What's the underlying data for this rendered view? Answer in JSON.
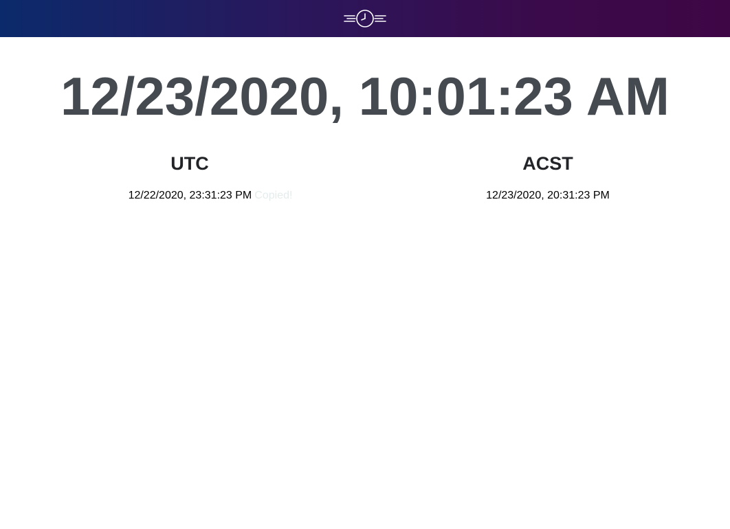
{
  "header": {
    "logo_icon": "clock-speed-icon",
    "gradient": [
      "#0b2a6b",
      "#3e0645"
    ]
  },
  "main": {
    "local_time": "12/23/2020, 10:01:23 AM",
    "color": "#454a51"
  },
  "zones": [
    {
      "name": "UTC",
      "time": "12/22/2020, 23:31:23 PM",
      "copied_label": "Copied!"
    },
    {
      "name": "ACST",
      "time": "12/23/2020, 20:31:23 PM"
    }
  ]
}
